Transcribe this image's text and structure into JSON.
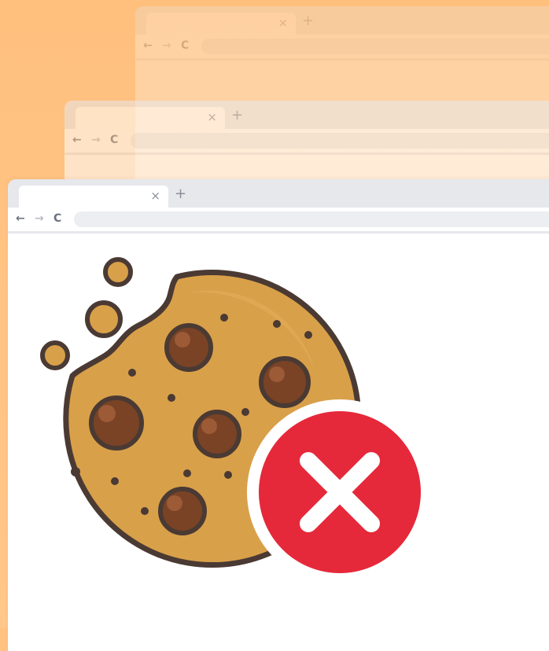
{
  "windows": {
    "back_1": {
      "tab_close_glyph": "×",
      "tab_new_glyph": "+",
      "nav_back_glyph": "←",
      "nav_forward_glyph": "→",
      "nav_reload_glyph": "C"
    },
    "back_2": {
      "tab_close_glyph": "×",
      "tab_new_glyph": "+",
      "nav_back_glyph": "←",
      "nav_forward_glyph": "→",
      "nav_reload_glyph": "C"
    },
    "front": {
      "tab_close_glyph": "×",
      "tab_new_glyph": "+",
      "nav_back_glyph": "←",
      "nav_forward_glyph": "→",
      "nav_reload_glyph": "C"
    }
  },
  "illustration": {
    "subject": "cookie-icon",
    "status": "blocked-icon"
  },
  "colors": {
    "background": "#ffc280",
    "chrome": "#e6e8ec",
    "cookie": "#d9a04a",
    "cookie_shade": "#c98f3e",
    "chip": "#7a4326",
    "outline": "#4a3a33",
    "block_red": "#e5293a"
  }
}
